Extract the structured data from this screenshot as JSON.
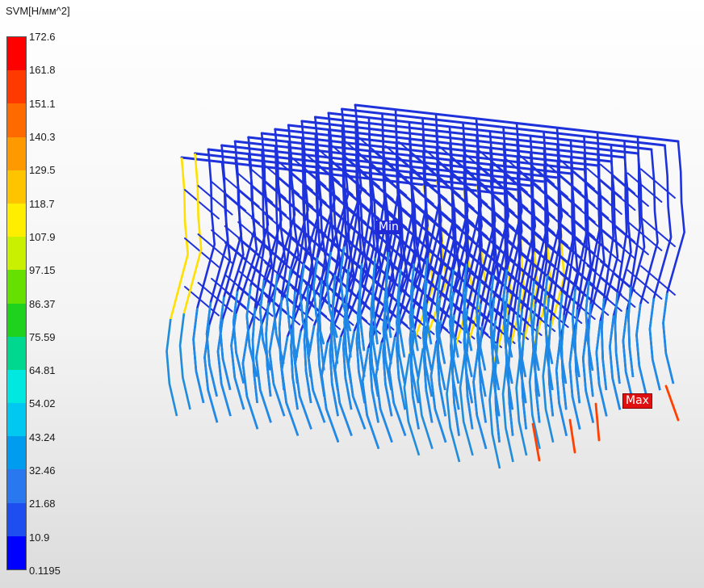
{
  "legend": {
    "title": "SVM[Н/мм^2]",
    "ticks": [
      "172.6",
      "161.8",
      "151.1",
      "140.3",
      "129.5",
      "118.7",
      "107.9",
      "97.15",
      "86.37",
      "75.59",
      "64.81",
      "54.02",
      "43.24",
      "32.46",
      "21.68",
      "10.9",
      "0.1195"
    ],
    "band_colors": [
      "#ff0000",
      "#ff3a00",
      "#ff6a00",
      "#ff9900",
      "#ffc400",
      "#ffee00",
      "#c8f000",
      "#66e000",
      "#1ed21e",
      "#00d890",
      "#00e8e0",
      "#00c8f0",
      "#009cf0",
      "#2a78f0",
      "#1e4ef0",
      "#0000ff"
    ]
  },
  "markers": {
    "min_label": "Min",
    "max_label": "Max"
  },
  "colors": {
    "structure_base": "#1e32dc",
    "structure_mid": "#1e8ce6",
    "structure_hot": "#ffe000",
    "structure_peak": "#ff4000"
  }
}
